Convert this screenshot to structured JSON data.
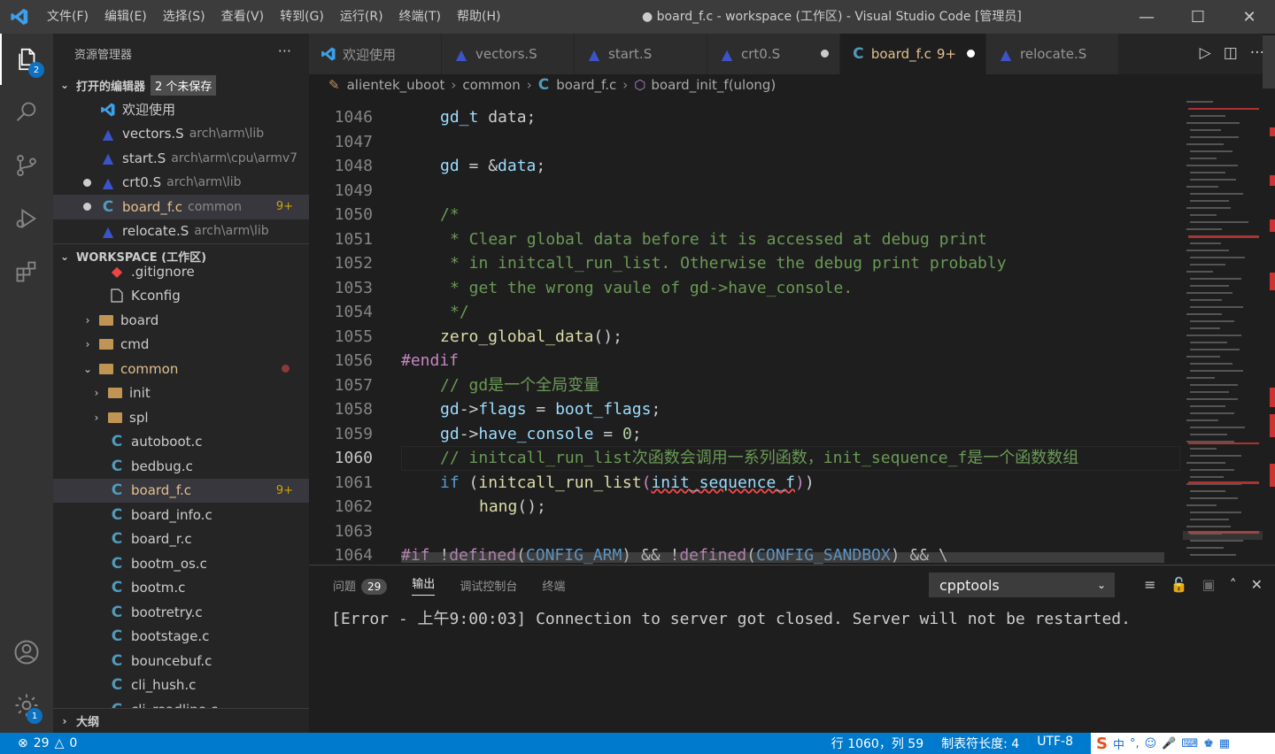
{
  "titlebar": {
    "menus": [
      "文件(F)",
      "编辑(E)",
      "选择(S)",
      "查看(V)",
      "转到(G)",
      "运行(R)",
      "终端(T)",
      "帮助(H)"
    ],
    "title": "● board_f.c - workspace (工作区) - Visual Studio Code [管理员]"
  },
  "activity": {
    "explorer_badge": "2",
    "settings_badge": "1"
  },
  "sidebar": {
    "title": "资源管理器",
    "open_editors_label": "打开的编辑器",
    "unsaved_label": "2 个未保存",
    "open_editors": [
      {
        "name": "欢迎使用",
        "desc": "",
        "icon": "vscode-icon"
      },
      {
        "name": "vectors.S",
        "desc": "arch\\arm\\lib",
        "icon": "asm-icon"
      },
      {
        "name": "start.S",
        "desc": "arch\\arm\\cpu\\armv7",
        "icon": "asm-icon"
      },
      {
        "name": "crt0.S",
        "desc": "arch\\arm\\lib",
        "icon": "asm-icon"
      },
      {
        "name": "board_f.c",
        "desc": "common",
        "icon": "c-icon",
        "count": "9+"
      },
      {
        "name": "relocate.S",
        "desc": "arch\\arm\\lib",
        "icon": "asm-icon"
      }
    ],
    "workspace_label": "WORKSPACE (工作区)",
    "tree": {
      "gitignore": ".gitignore",
      "kconfig": "Kconfig",
      "board": "board",
      "cmd": "cmd",
      "common": "common",
      "init": "init",
      "spl": "spl",
      "files": [
        "autoboot.c",
        "bedbug.c",
        "board_f.c",
        "board_info.c",
        "board_r.c",
        "bootm_os.c",
        "bootm.c",
        "bootretry.c",
        "bootstage.c",
        "bouncebuf.c",
        "cli_hush.c",
        "cli_readline.c"
      ],
      "board_f_count": "9+"
    },
    "outline_label": "大纲"
  },
  "tabs": [
    {
      "label": "欢迎使用",
      "icon": "vscode-icon"
    },
    {
      "label": "vectors.S",
      "icon": "asm-icon"
    },
    {
      "label": "start.S",
      "icon": "asm-icon"
    },
    {
      "label": "crt0.S",
      "icon": "asm-icon"
    },
    {
      "label": "board_f.c",
      "count": "9+",
      "icon": "c-icon"
    },
    {
      "label": "relocate.S",
      "icon": "asm-icon"
    }
  ],
  "breadcrumb": [
    "alientek_uboot",
    "common",
    "board_f.c",
    "board_init_f(ulong)"
  ],
  "editor": {
    "line_numbers": [
      "1046",
      "1047",
      "1048",
      "1049",
      "1050",
      "1051",
      "1052",
      "1053",
      "1054",
      "1055",
      "1056",
      "1057",
      "1058",
      "1059",
      "1060",
      "1061",
      "1062",
      "1063",
      "1064"
    ],
    "current_line": "1060"
  },
  "panel": {
    "tabs": [
      "问题",
      "输出",
      "调试控制台",
      "终端"
    ],
    "problems_count": "29",
    "channel": "cpptools",
    "output": "[Error - 上午9:00:03] Connection to server got closed. Server will not be restarted."
  },
  "status": {
    "errors": "29",
    "warnings": "0",
    "position": "行 1060，列 59",
    "tab_size": "制表符长度: 4",
    "encoding": "UTF-8"
  },
  "ime": {
    "lang": "中"
  }
}
